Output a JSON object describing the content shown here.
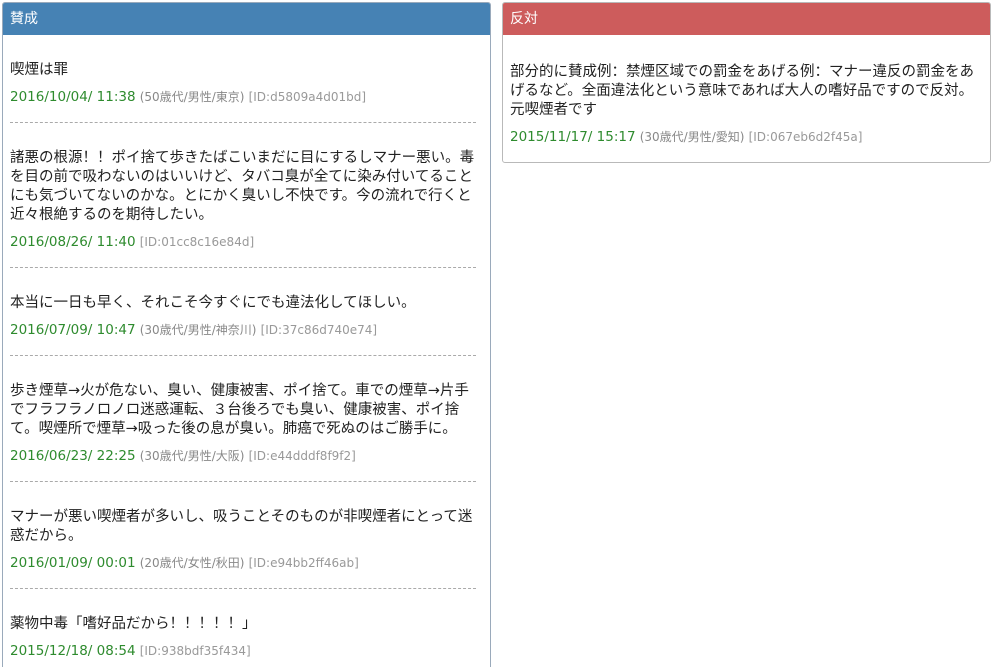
{
  "pro": {
    "header": "賛成",
    "posts": [
      {
        "text": "喫煙は罪",
        "date": "2016/10/04/ 11:38",
        "user": "(50歳代/男性/東京)",
        "id": "[ID:d5809a4d01bd]"
      },
      {
        "text": "諸悪の根源！！ポイ捨て歩きたばこいまだに目にするしマナー悪い。毒を目の前で吸わないのはいいけど、タバコ臭が全てに染み付いてることにも気づいてないのかな。とにかく臭いし不快です。今の流れで行くと近々根絶するのを期待したい。",
        "date": "2016/08/26/ 11:40",
        "user": "",
        "id": "[ID:01cc8c16e84d]"
      },
      {
        "text": "本当に一日も早く、それこそ今すぐにでも違法化してほしい。",
        "date": "2016/07/09/ 10:47",
        "user": "(30歳代/男性/神奈川)",
        "id": "[ID:37c86d740e74]"
      },
      {
        "text": "歩き煙草→火が危ない、臭い、健康被害、ポイ捨て。車での煙草→片手でフラフラノロノロ迷惑運転、３台後ろでも臭い、健康被害、ポイ捨て。喫煙所で煙草→吸った後の息が臭い。肺癌で死ぬのはご勝手に。",
        "date": "2016/06/23/ 22:25",
        "user": "(30歳代/男性/大阪)",
        "id": "[ID:e44dddf8f9f2]"
      },
      {
        "text": "マナーが悪い喫煙者が多いし、吸うことそのものが非喫煙者にとって迷惑だから。",
        "date": "2016/01/09/ 00:01",
        "user": "(20歳代/女性/秋田)",
        "id": "[ID:e94bb2ff46ab]"
      },
      {
        "text": "薬物中毒「嗜好品だから！！！！！」",
        "date": "2015/12/18/ 08:54",
        "user": "",
        "id": "[ID:938bdf35f434]"
      }
    ]
  },
  "con": {
    "header": "反対",
    "posts": [
      {
        "text": "部分的に賛成例：禁煙区域での罰金をあげる例：マナー違反の罰金をあげるなど。全面違法化という意味であれば大人の嗜好品ですので反対。元喫煙者です",
        "date": "2015/11/17/ 15:17",
        "user": "(30歳代/男性/愛知)",
        "id": "[ID:067eb6d2f45a]"
      }
    ]
  }
}
